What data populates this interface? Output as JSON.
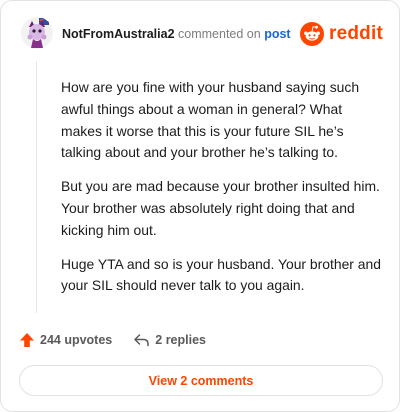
{
  "comment": {
    "username": "NotFromAustralia2",
    "commented_on_text": "commented on",
    "post_link_text": "post",
    "paragraphs": [
      "How are you fine with your husband saying such awful things about a woman in general? What makes it worse that this is your future SIL he’s talking about and your brother he’s talking to.",
      "But you are mad because your brother insulted him. Your brother was absolutely right doing that and kicking him out.",
      "Huge YTA and so is your husband. Your brother and your SIL should never talk to you again."
    ],
    "upvotes_label": "244 upvotes",
    "replies_label": "2 replies",
    "view_comments_label": "View 2 comments"
  },
  "brand": {
    "name": "reddit",
    "accent_color": "#ff4500",
    "link_color": "#1a66d6"
  },
  "icons": {
    "avatar": "snoo-avatar-icon",
    "logo": "reddit-logo-icon",
    "upvote": "upvote-arrow-icon",
    "reply": "reply-arrow-icon"
  }
}
